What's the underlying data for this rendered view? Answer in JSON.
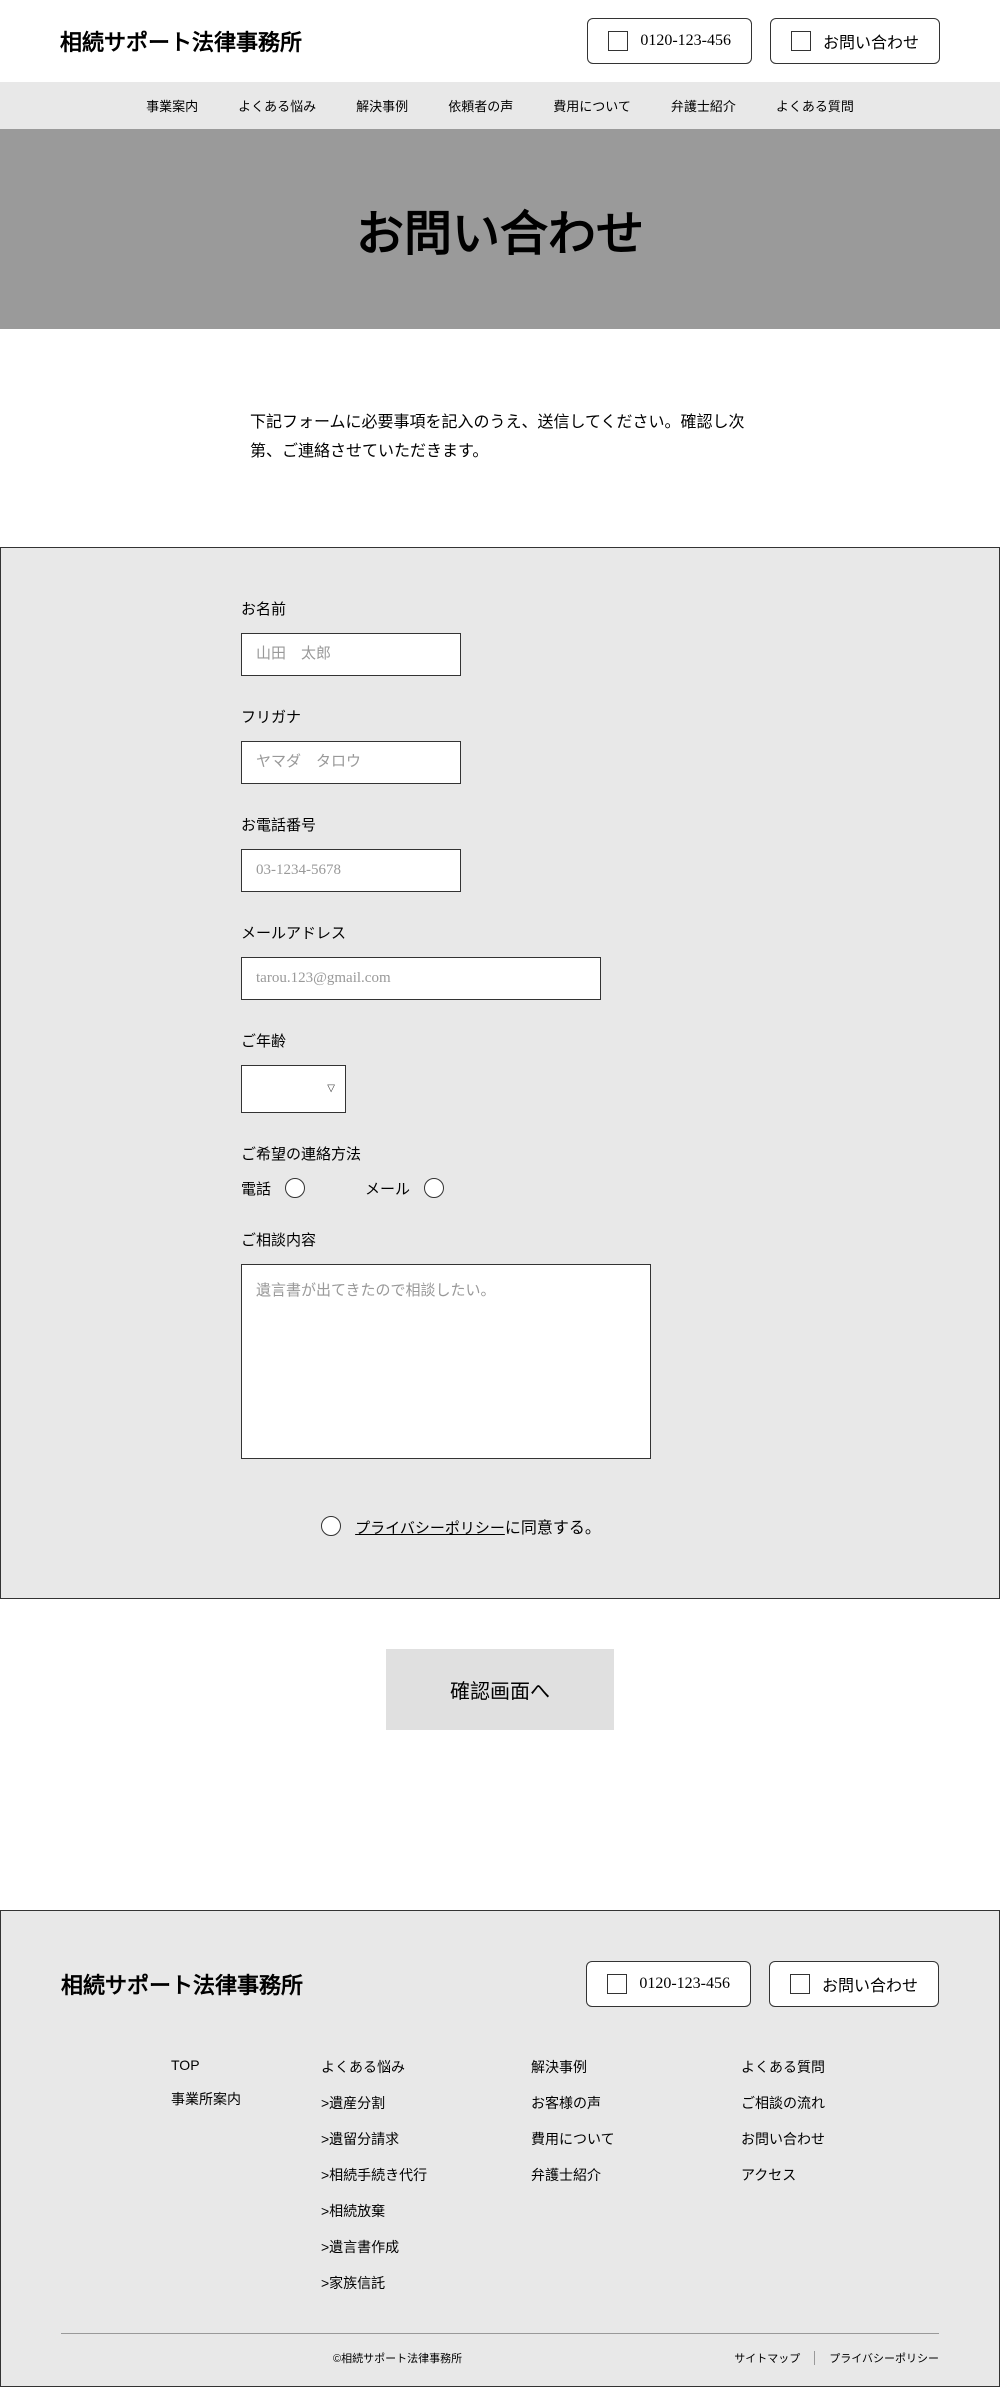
{
  "site_name": "相続サポート法律事務所",
  "header": {
    "phone": "0120-123-456",
    "contact": "お問い合わせ"
  },
  "nav": [
    "事業案内",
    "よくある悩み",
    "解決事例",
    "依頼者の声",
    "費用について",
    "弁護士紹介",
    "よくある質問"
  ],
  "hero_title": "お問い合わせ",
  "intro_text": "下記フォームに必要事項を記入のうえ、送信してください。確認し次第、ご連絡させていただきます。",
  "form": {
    "name": {
      "label": "お名前",
      "placeholder": "山田　太郎"
    },
    "furigana": {
      "label": "フリガナ",
      "placeholder": "ヤマダ　タロウ"
    },
    "tel": {
      "label": "お電話番号",
      "placeholder": "03-1234-5678"
    },
    "email": {
      "label": "メールアドレス",
      "placeholder": "tarou.123@gmail.com"
    },
    "age": {
      "label": "ご年齢"
    },
    "contact_method": {
      "label": "ご希望の連絡方法",
      "opt_tel": "電話",
      "opt_mail": "メール"
    },
    "content": {
      "label": "ご相談内容",
      "placeholder": "遺言書が出てきたので相談したい。"
    },
    "privacy": {
      "link": "プライバシーポリシー",
      "suffix": "に同意する。"
    },
    "submit": "確認画面へ"
  },
  "footer": {
    "col1": [
      "TOP",
      "事業所案内"
    ],
    "col2": [
      "よくある悩み",
      ">遺産分割",
      ">遺留分請求",
      ">相続手続き代行",
      ">相続放棄",
      ">遺言書作成",
      ">家族信託"
    ],
    "col3": [
      "解決事例",
      "お客様の声",
      "費用について",
      "弁護士紹介"
    ],
    "col4": [
      "よくある質問",
      "ご相談の流れ",
      "お問い合わせ",
      "アクセス"
    ],
    "copyright": "©相続サポート法律事務所",
    "sitemap": "サイトマップ",
    "privacy": "プライバシーポリシー"
  }
}
